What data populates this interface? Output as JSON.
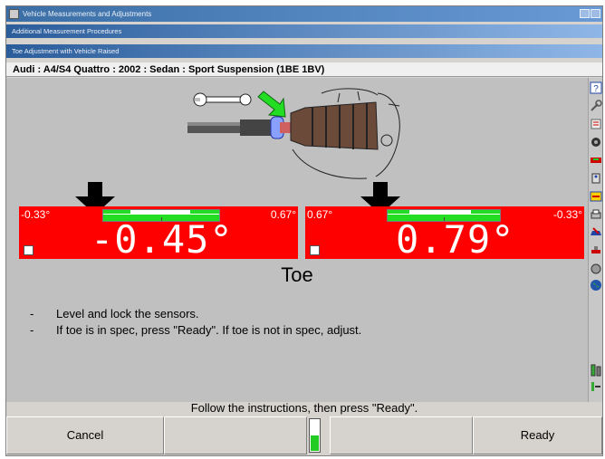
{
  "window": {
    "title": "Vehicle Measurements and Adjustments",
    "subtitle": "Additional Measurement Procedures",
    "section": "Toe Adjustment with Vehicle Raised"
  },
  "vehicle_info": "Audi : A4/S4 Quattro : 2002 : Sedan : Sport Suspension (1BE 1BV)",
  "gauges": {
    "left": {
      "value": "-0.45°",
      "min_label": "-0.33°",
      "max_label": "0.67°"
    },
    "right": {
      "value": "0.79°",
      "min_label": "0.67°",
      "max_label": "-0.33°"
    }
  },
  "measurement_label": "Toe",
  "instructions": [
    {
      "bullet": "-",
      "text": "Level and lock the sensors."
    },
    {
      "bullet": "-",
      "text": "If toe is in spec, press \"Ready\".  If toe is not in spec, adjust."
    }
  ],
  "status_message": "Follow the instructions, then press \"Ready\".",
  "buttons": {
    "cancel": "Cancel",
    "ready": "Ready"
  },
  "level_meter": {
    "fill_fraction": 0.5
  },
  "sidebar_icons": [
    "help-icon",
    "wrench-icon",
    "specs-icon",
    "camera-icon",
    "alignment-icon",
    "sensor-icon",
    "readings-icon",
    "printer-icon",
    "vehicle-icon",
    "tools-icon",
    "globe-icon",
    "adjust-icon",
    "exit-icon"
  ],
  "colors": {
    "gauge_bg": "#ff0000",
    "spec_band": "#22dd22",
    "titlebar": "#3a6ea5"
  }
}
